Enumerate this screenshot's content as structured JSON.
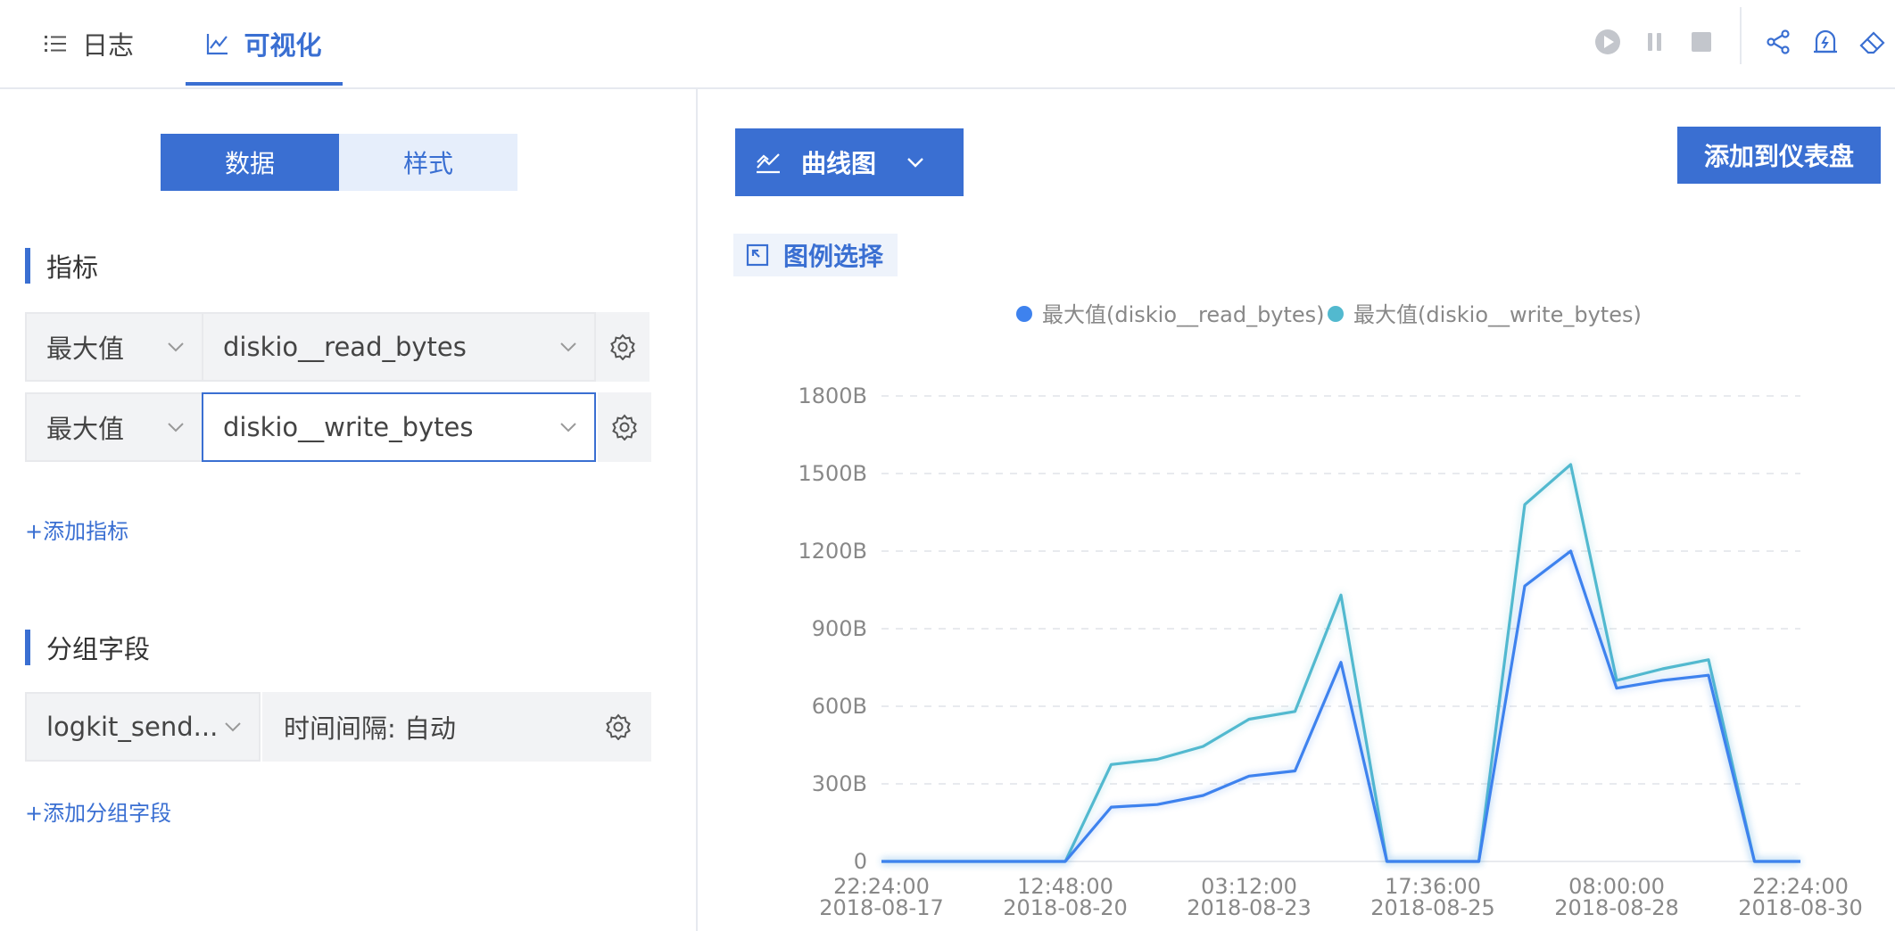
{
  "tabs": {
    "logs": "日志",
    "visualize": "可视化"
  },
  "left": {
    "segments": {
      "data": "数据",
      "style": "样式"
    },
    "metrics_title": "指标",
    "metrics": [
      {
        "agg": "最大值",
        "field": "diskio__read_bytes"
      },
      {
        "agg": "最大值",
        "field": "diskio__write_bytes"
      }
    ],
    "add_metric": "+添加指标",
    "group_title": "分组字段",
    "group_field": "logkit_send...",
    "group_interval": "时间间隔: 自动",
    "add_group": "+添加分组字段"
  },
  "right": {
    "chart_type": "曲线图",
    "add_to_dashboard": "添加到仪表盘",
    "legend_select": "图例选择"
  },
  "colors": {
    "accent": "#3a6fd2",
    "series1": "#3e82ee",
    "series2": "#52b9cf"
  },
  "chart_data": {
    "type": "line",
    "title": "",
    "xlabel": "",
    "ylabel": "",
    "legend_position": "top",
    "grid": true,
    "ylim": [
      0,
      1800
    ],
    "y_ticks": [
      "0",
      "300B",
      "600B",
      "900B",
      "1200B",
      "1500B",
      "1800B"
    ],
    "x_tick_labels": [
      {
        "time": "22:24:00",
        "date": "2018-08-17"
      },
      {
        "time": "12:48:00",
        "date": "2018-08-20"
      },
      {
        "time": "03:12:00",
        "date": "2018-08-23"
      },
      {
        "time": "17:36:00",
        "date": "2018-08-25"
      },
      {
        "time": "08:00:00",
        "date": "2018-08-28"
      },
      {
        "time": "22:24:00",
        "date": "2018-08-30"
      }
    ],
    "series": [
      {
        "name": "最大值(diskio__read_bytes)",
        "values": [
          0,
          0,
          0,
          0,
          0,
          210,
          220,
          255,
          330,
          350,
          770,
          0,
          0,
          0,
          1065,
          1200,
          670,
          700,
          720,
          0,
          0
        ]
      },
      {
        "name": "最大值(diskio__write_bytes)",
        "values": [
          0,
          0,
          0,
          0,
          0,
          375,
          395,
          445,
          550,
          580,
          1030,
          0,
          0,
          0,
          1380,
          1535,
          700,
          745,
          780,
          0,
          0
        ]
      }
    ]
  }
}
